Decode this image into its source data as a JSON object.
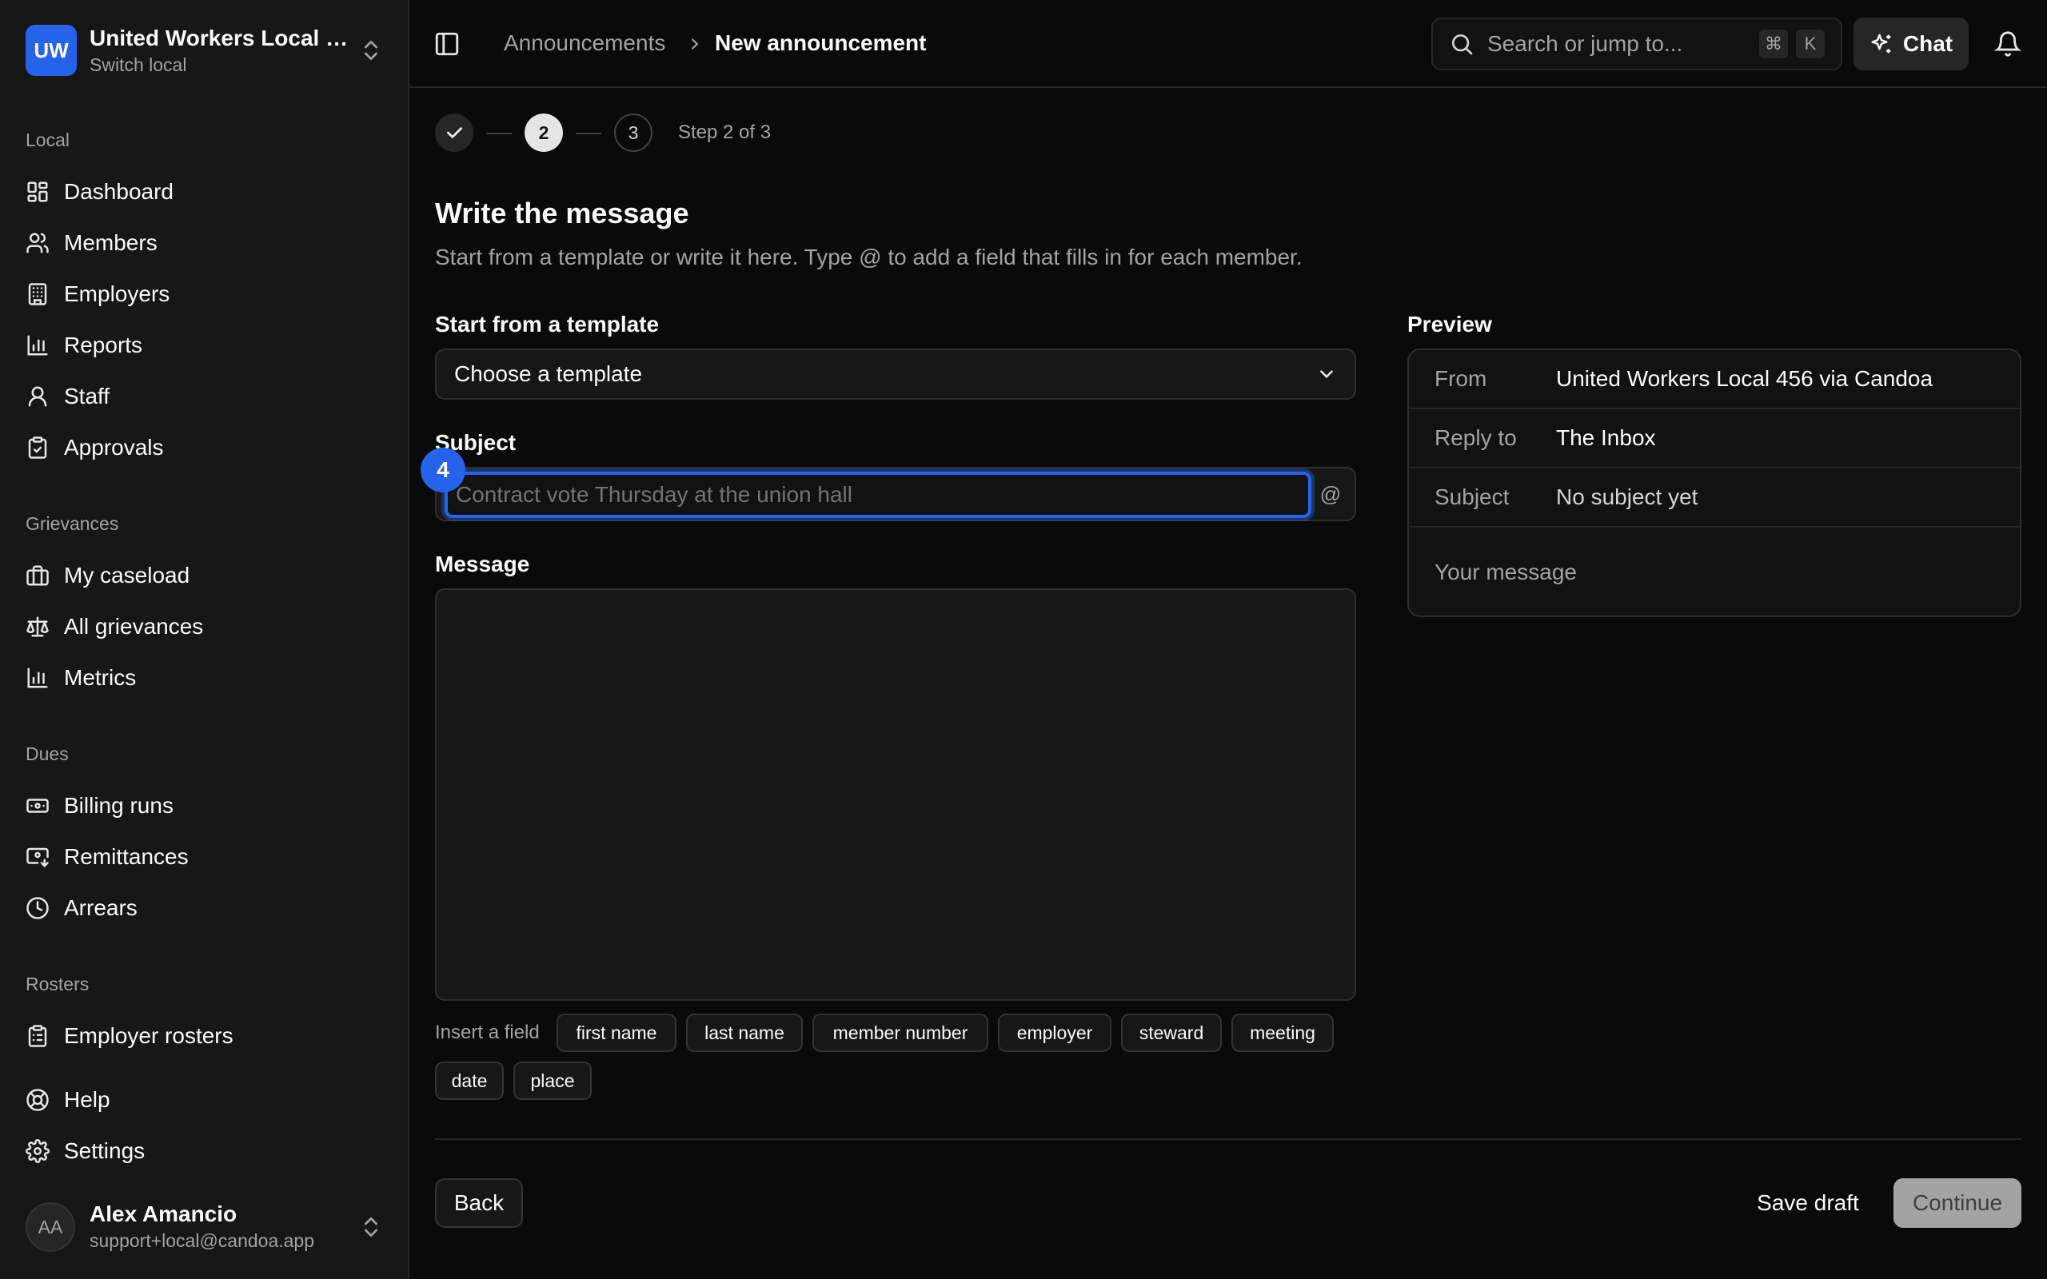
{
  "org": {
    "initials": "UW",
    "name": "United Workers Local 456",
    "switch_label": "Switch local"
  },
  "sidebar": {
    "sections": {
      "local": "Local",
      "grievances": "Grievances",
      "dues": "Dues",
      "rosters": "Rosters"
    },
    "local_items": [
      {
        "label": "Dashboard",
        "icon": "dashboard-icon"
      },
      {
        "label": "Members",
        "icon": "users-icon"
      },
      {
        "label": "Employers",
        "icon": "building-icon"
      },
      {
        "label": "Reports",
        "icon": "bar-chart-icon"
      },
      {
        "label": "Staff",
        "icon": "user-icon"
      },
      {
        "label": "Approvals",
        "icon": "clipboard-check-icon"
      }
    ],
    "grievance_items": [
      {
        "label": "My caseload",
        "icon": "briefcase-icon"
      },
      {
        "label": "All grievances",
        "icon": "scale-icon"
      },
      {
        "label": "Metrics",
        "icon": "bar-chart-icon"
      }
    ],
    "dues_items": [
      {
        "label": "Billing runs",
        "icon": "banknote-icon"
      },
      {
        "label": "Remittances",
        "icon": "banknote-arrow-icon"
      },
      {
        "label": "Arrears",
        "icon": "clock-icon"
      }
    ],
    "roster_items": [
      {
        "label": "Employer rosters",
        "icon": "clipboard-list-icon"
      }
    ],
    "bottom_items": [
      {
        "label": "Help",
        "icon": "lifebuoy-icon"
      },
      {
        "label": "Settings",
        "icon": "gear-icon"
      }
    ]
  },
  "user": {
    "initials": "AA",
    "name": "Alex Amancio",
    "email": "support+local@candoa.app"
  },
  "topbar": {
    "breadcrumb_parent": "Announcements",
    "breadcrumb_current": "New announcement",
    "search_placeholder": "Search or jump to...",
    "shortcut_key1": "⌘",
    "shortcut_key2": "K",
    "chat_label": "Chat"
  },
  "stepper": {
    "current": "2",
    "next": "3",
    "label": "Step 2 of 3"
  },
  "form": {
    "title": "Write the message",
    "description": "Start from a template or write it here. Type @ to add a field that fills in for each member.",
    "template_label": "Start from a template",
    "template_value": "Choose a template",
    "subject_label": "Subject",
    "subject_placeholder": "Contract vote Thursday at the union hall",
    "subject_value": "",
    "at_symbol": "@",
    "badge": "4",
    "message_label": "Message",
    "message_value": "",
    "insert_label": "Insert a field",
    "fields": [
      "first name",
      "last name",
      "member number",
      "employer",
      "steward",
      "meeting",
      "date",
      "place"
    ]
  },
  "preview": {
    "label": "Preview",
    "from_key": "From",
    "from_value": "United Workers Local 456 via Candoa",
    "reply_key": "Reply to",
    "reply_value": "The Inbox",
    "subject_key": "Subject",
    "subject_value": "No subject yet",
    "message_placeholder": "Your message"
  },
  "footer": {
    "back": "Back",
    "save": "Save draft",
    "continue": "Continue"
  },
  "colors": {
    "accent": "#2563eb",
    "background": "#0a0a0a",
    "sidebar": "#171717"
  }
}
